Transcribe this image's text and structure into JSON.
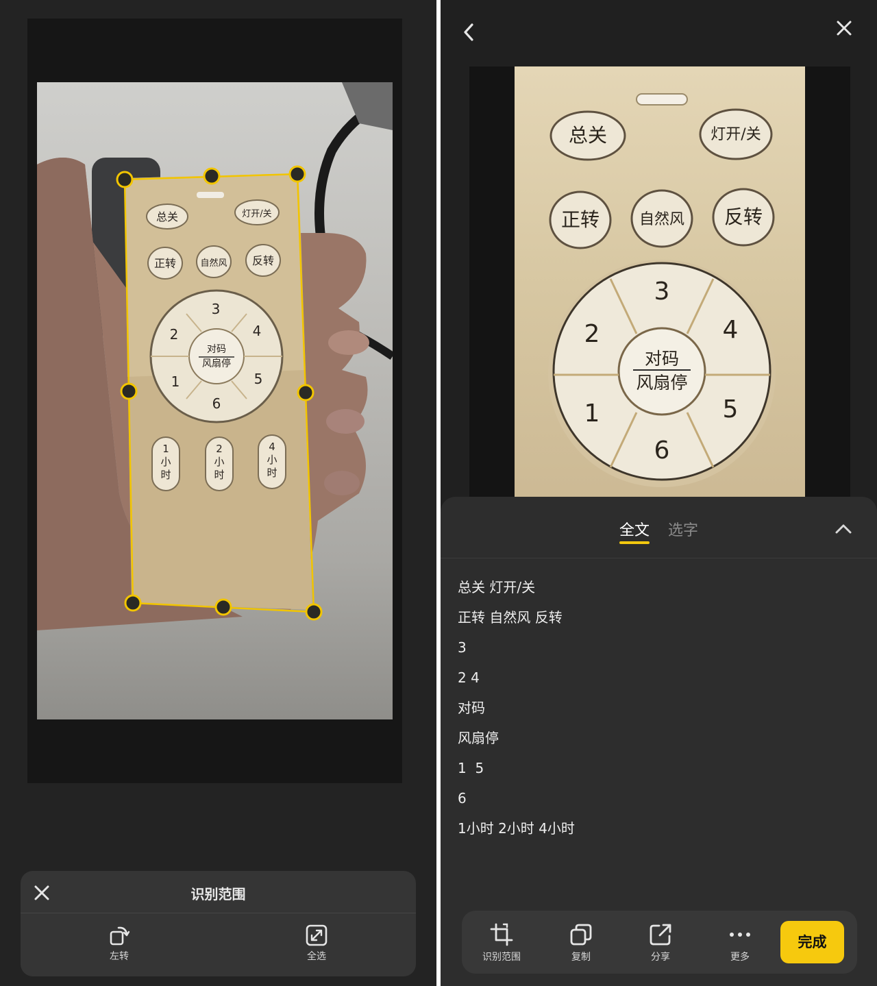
{
  "left_panel": {
    "toolbar": {
      "title": "识别范围",
      "rotate_left_label": "左转",
      "select_all_label": "全选"
    },
    "remote_labels": {
      "power_off": "总关",
      "light_toggle": "灯开/关",
      "forward": "正转",
      "natural_wind": "自然风",
      "reverse": "反转",
      "pair_top": "对码",
      "pair_bottom": "风扇停",
      "timer_1": [
        "1",
        "小",
        "时"
      ],
      "timer_2": [
        "2",
        "小",
        "时"
      ],
      "timer_4": [
        "4",
        "小",
        "时"
      ]
    }
  },
  "right_panel": {
    "tabs": [
      {
        "label": "全文",
        "active": true
      },
      {
        "label": "选字",
        "active": false
      }
    ],
    "ocr_lines": [
      "总关 灯开/关",
      "正转 自然风 反转",
      "3",
      "2 4",
      "对码",
      "风扇停",
      "1  5",
      "6",
      "1小时 2小时 4小时"
    ],
    "bottom_bar": {
      "range_label": "识别范围",
      "copy_label": "复制",
      "share_label": "分享",
      "more_label": "更多",
      "done_label": "完成"
    }
  },
  "colors": {
    "accent": "#f6c90e",
    "crop_line": "#f2c500",
    "panel_bg": "#232323",
    "sheet_bg": "#2d2d2d"
  },
  "icons": [
    "close-icon",
    "rotate-left-icon",
    "select-all-icon",
    "back-chevron-icon",
    "collapse-chevron-icon",
    "crop-range-icon",
    "copy-icon",
    "share-icon",
    "more-icon"
  ]
}
